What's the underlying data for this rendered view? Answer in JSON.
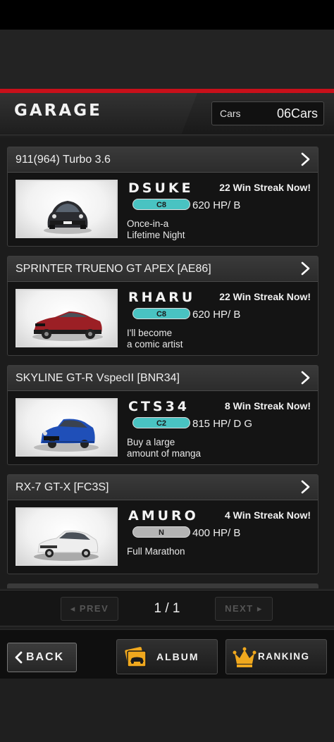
{
  "header": {
    "title": "GARAGE",
    "cars_label": "Cars",
    "cars_count": "06Cars"
  },
  "cars": [
    {
      "name": "911(964) Turbo 3.6",
      "driver": "DSUKE",
      "streak": "22 Win Streak Now!",
      "rank": "C8",
      "spec": "620 HP/ B",
      "tagline_1": "Once-in-a",
      "tagline_2": "Lifetime Night",
      "car_color": "#2b2c30",
      "car_icon": "porsche-964-turbo-car-image"
    },
    {
      "name": "SPRINTER TRUENO GT APEX [AE86]",
      "driver": "RHARU",
      "streak": "22 Win Streak Now!",
      "rank": "C8",
      "spec": "620 HP/ B",
      "tagline_1": "I'll become",
      "tagline_2": "a comic artist",
      "car_color": "#9b1f25",
      "car_icon": "ae86-trueno-car-image"
    },
    {
      "name": "SKYLINE GT-R VspecII [BNR34]",
      "driver": "CTS34",
      "streak": "8 Win Streak Now!",
      "rank": "C2",
      "spec": "815 HP/ D G",
      "tagline_1": "Buy a large",
      "tagline_2": "amount of manga",
      "car_color": "#1f4fb8",
      "car_icon": "skyline-r34-car-image"
    },
    {
      "name": "RX-7 GT-X [FC3S]",
      "driver": "AMURO",
      "streak": "4 Win Streak Now!",
      "rank": "N",
      "spec": "400 HP/ B",
      "tagline_1": "Full Marathon",
      "tagline_2": "",
      "car_color": "#eeeeee",
      "car_icon": "rx7-fc3s-car-image"
    }
  ],
  "pager": {
    "prev_label": "PREV",
    "page_text": "1 / 1",
    "next_label": "NEXT"
  },
  "footer": {
    "back_label": "BACK",
    "album_label": "ALBUM",
    "ranking_label": "RANKING"
  },
  "colors": {
    "accent_red": "#c8101a",
    "rank_teal": "#49c3c2",
    "rank_gray": "#b4b4b4",
    "icon_gold": "#f0a81e"
  }
}
